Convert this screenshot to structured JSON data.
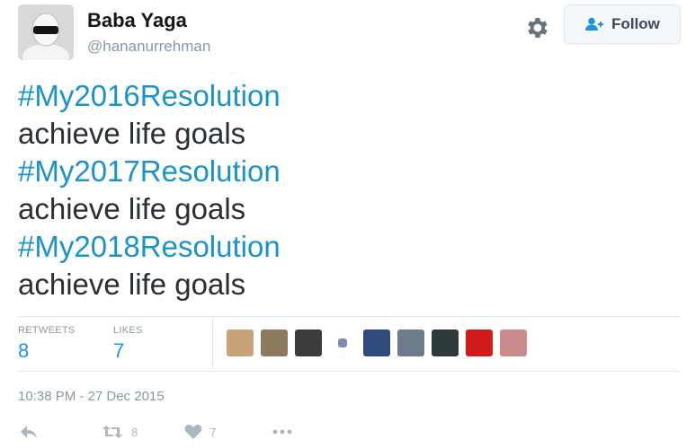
{
  "user": {
    "name": "Baba Yaga",
    "handle": "@hananurrehman"
  },
  "header": {
    "follow_label": "Follow"
  },
  "tweet": {
    "lines": [
      {
        "text": "#My2016Resolution",
        "kind": "hashtag"
      },
      {
        "text": "achieve life goals",
        "kind": "plain"
      },
      {
        "text": "#My2017Resolution",
        "kind": "hashtag"
      },
      {
        "text": "achieve life goals",
        "kind": "plain"
      },
      {
        "text": "#My2018Resolution",
        "kind": "hashtag"
      },
      {
        "text": "achieve life goals",
        "kind": "plain"
      }
    ]
  },
  "stats": {
    "retweets_label": "RETWEETS",
    "retweets": "8",
    "likes_label": "LIKES",
    "likes": "7"
  },
  "timestamp": "10:38 PM - 27 Dec 2015",
  "actions": {
    "retweet_count": "8",
    "like_count": "7"
  },
  "colors": {
    "hashtag": "#1a93c8",
    "stat_value": "#1b95e0",
    "muted": "#8899a6"
  },
  "liker_avatars": [
    "#c9a27a",
    "#8c7a5e",
    "#3c3c3c",
    "#7a8fb0",
    "#2f4a7d",
    "#6d7c8a",
    "#2e3a3a",
    "#d11a1a",
    "#c88a8a"
  ]
}
